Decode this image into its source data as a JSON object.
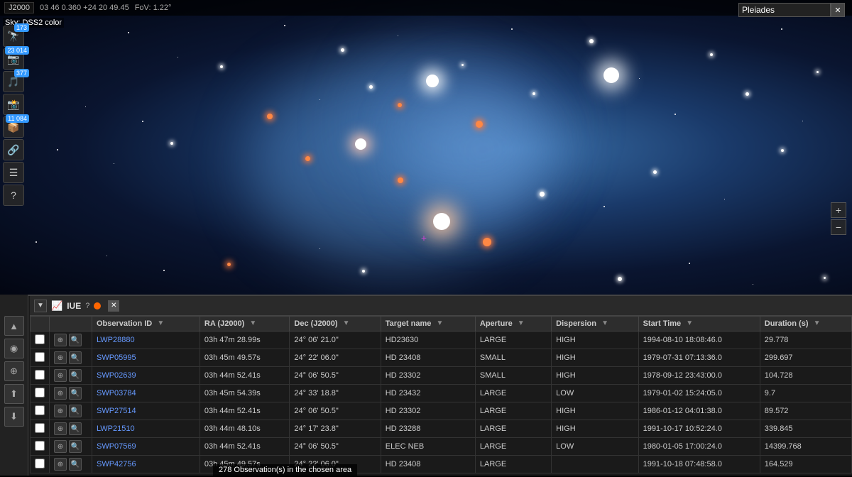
{
  "topbar": {
    "epoch": "J2000",
    "coords": "03 46 0.360 +24 20 49.45",
    "fov": "FoV: 1.22°"
  },
  "search": {
    "value": "Pleiades",
    "clear_label": "✕"
  },
  "sky_label": "Sky: DSS2 color",
  "sidebar": {
    "items": [
      {
        "label": "🔭",
        "badge": "173",
        "name": "catalog"
      },
      {
        "label": "📷",
        "badge": "23 014",
        "name": "images"
      },
      {
        "label": "🎵",
        "badge": "377",
        "name": "spectra"
      },
      {
        "label": "📸",
        "badge": "",
        "name": "photos"
      },
      {
        "label": "📦",
        "badge": "11 084",
        "name": "data"
      },
      {
        "label": "🔗",
        "badge": "",
        "name": "share"
      },
      {
        "label": "☰",
        "badge": "",
        "name": "menu"
      },
      {
        "label": "?",
        "badge": "",
        "name": "help"
      }
    ]
  },
  "panel": {
    "title": "IUE",
    "dot_color": "#ff6600",
    "question_label": "?",
    "close_label": "✕",
    "collapse_label": "▼"
  },
  "table": {
    "columns": [
      "",
      "",
      "",
      "Observation ID",
      "RA (J2000)",
      "Dec (J2000)",
      "Target name",
      "Aperture",
      "Dispersion",
      "Start Time",
      "Duration (s)"
    ],
    "rows": [
      {
        "obs_id": "LWP28880",
        "ra": "03h 47m 28.99s",
        "dec": "24° 06' 21.0\"",
        "target": "HD23630",
        "aperture": "LARGE",
        "dispersion": "HIGH",
        "start": "1994-08-10 18:08:46.0",
        "duration": "29.778"
      },
      {
        "obs_id": "SWP05995",
        "ra": "03h 45m 49.57s",
        "dec": "24° 22' 06.0\"",
        "target": "HD 23408",
        "aperture": "SMALL",
        "dispersion": "HIGH",
        "start": "1979-07-31 07:13:36.0",
        "duration": "299.697"
      },
      {
        "obs_id": "SWP02639",
        "ra": "03h 44m 52.41s",
        "dec": "24° 06' 50.5\"",
        "target": "HD 23302",
        "aperture": "SMALL",
        "dispersion": "HIGH",
        "start": "1978-09-12 23:43:00.0",
        "duration": "104.728"
      },
      {
        "obs_id": "SWP03784",
        "ra": "03h 45m 54.39s",
        "dec": "24° 33' 18.8\"",
        "target": "HD 23432",
        "aperture": "LARGE",
        "dispersion": "LOW",
        "start": "1979-01-02 15:24:05.0",
        "duration": "9.7"
      },
      {
        "obs_id": "SWP27514",
        "ra": "03h 44m 52.41s",
        "dec": "24° 06' 50.5\"",
        "target": "HD 23302",
        "aperture": "LARGE",
        "dispersion": "HIGH",
        "start": "1986-01-12 04:01:38.0",
        "duration": "89.572"
      },
      {
        "obs_id": "LWP21510",
        "ra": "03h 44m 48.10s",
        "dec": "24° 17' 23.8\"",
        "target": "HD 23288",
        "aperture": "LARGE",
        "dispersion": "HIGH",
        "start": "1991-10-17 10:52:24.0",
        "duration": "339.845"
      },
      {
        "obs_id": "SWP07569",
        "ra": "03h 44m 52.41s",
        "dec": "24° 06' 50.5\"",
        "target": "ELEC NEB",
        "aperture": "LARGE",
        "dispersion": "LOW",
        "start": "1980-01-05 17:00:24.0",
        "duration": "14399.768"
      },
      {
        "obs_id": "SWP42756",
        "ra": "03h 45m 49.57s",
        "dec": "24° 22' 06.0\"",
        "target": "HD 23408",
        "aperture": "LARGE",
        "dispersion": "",
        "start": "1991-10-18 07:48:58.0",
        "duration": "164.529"
      }
    ]
  },
  "status": {
    "text": "278 Observation(s) in the chosen area"
  },
  "zoom": {
    "plus": "+",
    "minus": "−"
  }
}
